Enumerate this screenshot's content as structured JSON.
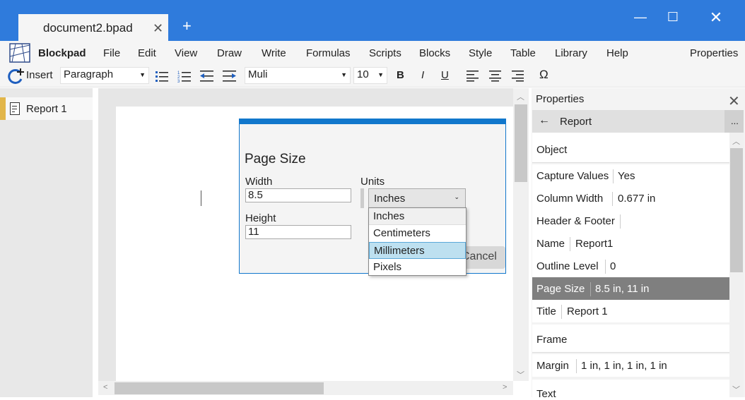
{
  "tab": {
    "title": "document2.bpad"
  },
  "app": {
    "name": "Blockpad"
  },
  "menu": [
    "File",
    "Edit",
    "View",
    "Draw",
    "Write",
    "Formulas",
    "Scripts",
    "Blocks",
    "Style",
    "Table",
    "Library",
    "Help"
  ],
  "menu_properties": "Properties",
  "toolbar": {
    "insert": "Insert",
    "paragraph": "Paragraph",
    "font": "Muli",
    "size": "10",
    "bold": "B",
    "italic": "I",
    "underline": "U",
    "omega": "Ω"
  },
  "left": {
    "report": "Report 1"
  },
  "dialog": {
    "title": "Page Size",
    "width_label": "Width",
    "width_value": "8.5",
    "height_label": "Height",
    "height_value": "11",
    "units_label": "Units",
    "units_value": "Inches",
    "options": [
      "Inches",
      "Centimeters",
      "Millimeters",
      "Pixels"
    ],
    "cancel": "Cancel"
  },
  "properties": {
    "header": "Properties",
    "back_title": "Report",
    "more": "...",
    "section_object": "Object",
    "rows": [
      {
        "k": "Capture Values",
        "v": "Yes"
      },
      {
        "k": "Column Width",
        "v": "0.677 in"
      },
      {
        "k": "Header & Footer",
        "v": ""
      },
      {
        "k": "Name",
        "v": "Report1"
      },
      {
        "k": "Outline Level",
        "v": "0"
      },
      {
        "k": "Page Size",
        "v": "8.5 in, 11 in"
      },
      {
        "k": "Title",
        "v": "Report 1"
      }
    ],
    "section_frame": "Frame",
    "margin_k": "Margin",
    "margin_v": "1 in, 1 in, 1 in, 1 in",
    "section_text": "Text"
  },
  "colors": {
    "accent": "#2f7bdc",
    "dialog_accent": "#1177cc",
    "selected_row": "#7f7f7f",
    "hover_option": "#bde0f0",
    "tab_marker": "#e2b64a"
  }
}
